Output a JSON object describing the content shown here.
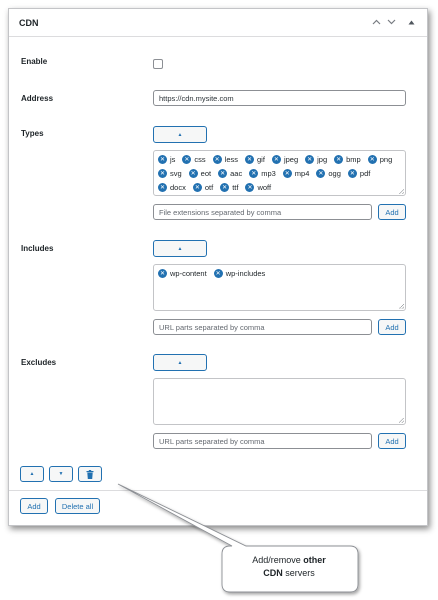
{
  "panel": {
    "title": "CDN",
    "controls": {
      "up": "∧",
      "down": "∨",
      "collapse": "▲"
    }
  },
  "fields": {
    "enable": {
      "label": "Enable",
      "checked": false
    },
    "address": {
      "label": "Address",
      "value": "https://cdn.mysite.com"
    },
    "types": {
      "label": "Types",
      "toggle_icon": "▲",
      "tags": [
        "js",
        "css",
        "less",
        "gif",
        "jpeg",
        "jpg",
        "bmp",
        "png",
        "svg",
        "eot",
        "aac",
        "mp3",
        "mp4",
        "ogg",
        "pdf",
        "docx",
        "otf",
        "ttf",
        "woff"
      ],
      "placeholder": "File extensions separated by comma",
      "add_label": "Add"
    },
    "includes": {
      "label": "Includes",
      "toggle_icon": "▲",
      "tags": [
        "wp-content",
        "wp-includes"
      ],
      "placeholder": "URL parts separated by comma",
      "add_label": "Add"
    },
    "excludes": {
      "label": "Excludes",
      "toggle_icon": "▲",
      "tags": [],
      "placeholder": "URL parts separated by comma",
      "add_label": "Add"
    }
  },
  "row_controls": {
    "move_up": "▲",
    "move_down": "▼",
    "delete_icon": "trash-icon"
  },
  "footer": {
    "add_label": "Add",
    "delete_all_label": "Delete all"
  },
  "callout": {
    "text_before": "Add/remove ",
    "text_bold_1": "other",
    "text_bold_2": "CDN",
    "text_after": " servers"
  },
  "colors": {
    "accent": "#2271b1",
    "border": "#8c8f94",
    "text": "#1d2327"
  }
}
